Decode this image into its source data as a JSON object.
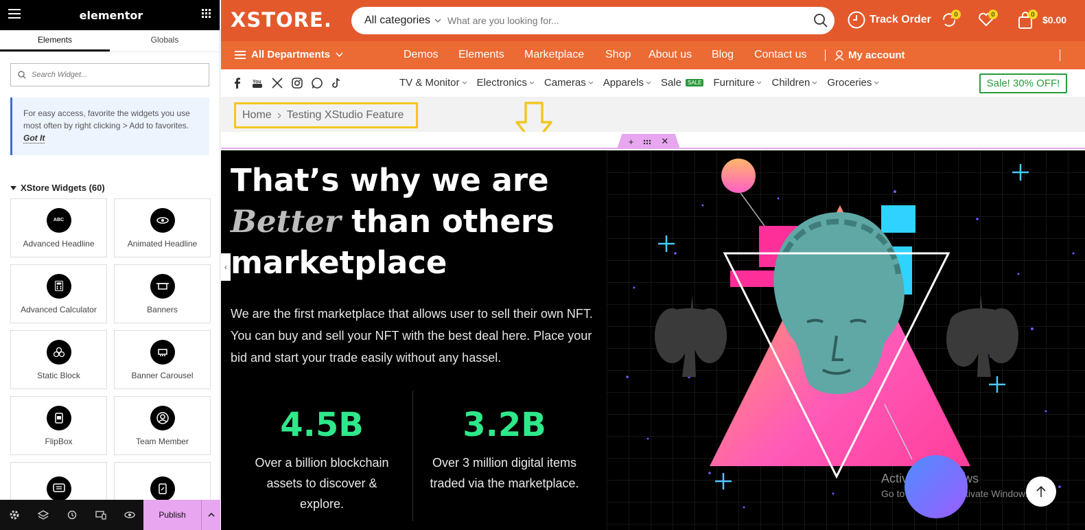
{
  "panel": {
    "logo": "elementor",
    "tabs": [
      "Elements",
      "Globals"
    ],
    "search_placeholder": "Search Widget...",
    "tip_text": "For easy access, favorite the widgets you use most often by right clicking > Add to favorites.",
    "tip_link": "Got It",
    "category": "XStore Widgets (60)",
    "widgets": [
      {
        "label": "Advanced Headline",
        "icon": "abc-icon"
      },
      {
        "label": "Animated Headline",
        "icon": "eye-icon"
      },
      {
        "label": "Advanced Calculator",
        "icon": "calculator-icon"
      },
      {
        "label": "Banners",
        "icon": "banner-icon"
      },
      {
        "label": "Static Block",
        "icon": "blocks-icon"
      },
      {
        "label": "Banner Carousel",
        "icon": "carousel-icon"
      },
      {
        "label": "FlipBox",
        "icon": "flipbox-icon"
      },
      {
        "label": "Team Member",
        "icon": "user-icon"
      },
      {
        "label": "",
        "icon": "chat-icon"
      },
      {
        "label": "",
        "icon": "document-icon"
      }
    ],
    "publish": "Publish"
  },
  "header": {
    "brand": "XSTORE.",
    "category_select": "All categories",
    "search_placeholder": "What are you looking for...",
    "track_order": "Track Order",
    "compare_count": "0",
    "wishlist_count": "0",
    "cart_count": "0",
    "cart_amount": "$0.00"
  },
  "nav": {
    "all_departments": "All Departments",
    "links": [
      "Demos",
      "Elements",
      "Marketplace",
      "Shop",
      "About us",
      "Blog",
      "Contact us"
    ],
    "account": "My account"
  },
  "subnav": {
    "categories": [
      "TV & Monitor",
      "Electronics",
      "Cameras",
      "Apparels",
      "Sale",
      "Furniture",
      "Children",
      "Groceries"
    ],
    "sale_badge": "SALE",
    "sale_button": "Sale! 30% OFF!"
  },
  "breadcrumb": {
    "home": "Home",
    "current": "Testing XStudio Feature"
  },
  "hero": {
    "title_line1": "That’s why we are",
    "title_em": "Better",
    "title_line2_rest": " than others",
    "title_line3": "marketplace",
    "paragraph": "We are the first marketplace that allows user to sell their own NFT. You can buy and sell your NFT with the best deal here. Place your bid and start your trade easily without any hassel.",
    "stats": [
      {
        "value": "4.5B",
        "text": "Over a billion blockchain assets to discover & explore."
      },
      {
        "value": "3.2B",
        "text": "Over 3 million digital items traded via the marketplace."
      }
    ]
  },
  "watermark": {
    "title": "Activate Windows",
    "subtitle": "Go to Settings to activate Windows."
  },
  "colors": {
    "header_orange": "#e4592b",
    "nav_orange": "#ec6a34",
    "stat_green": "#2ee88a",
    "sale_green": "#2a9a3b",
    "highlight_yellow": "#f3c623",
    "editor_pink": "#e7a6ef"
  }
}
